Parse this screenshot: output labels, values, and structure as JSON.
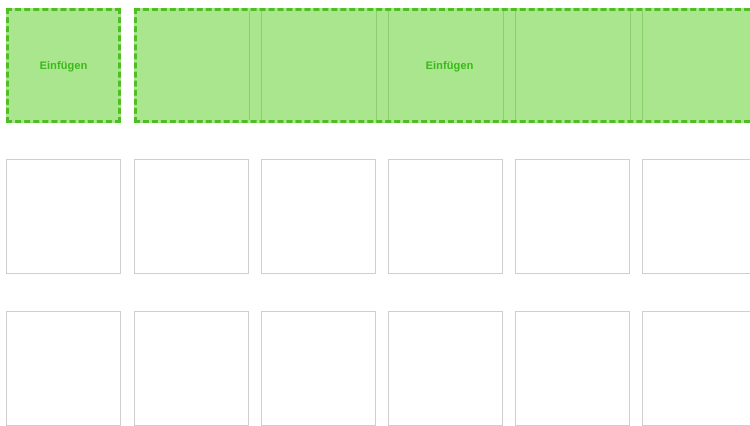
{
  "drop_zones": {
    "single": {
      "label": "Einfügen"
    },
    "wide": {
      "label": "Einfügen"
    }
  },
  "colors": {
    "drop_fill": "#a9e68d",
    "drop_border": "#4fbe23",
    "drop_text": "#3cb81d",
    "slot_border": "#cfcfcf"
  }
}
